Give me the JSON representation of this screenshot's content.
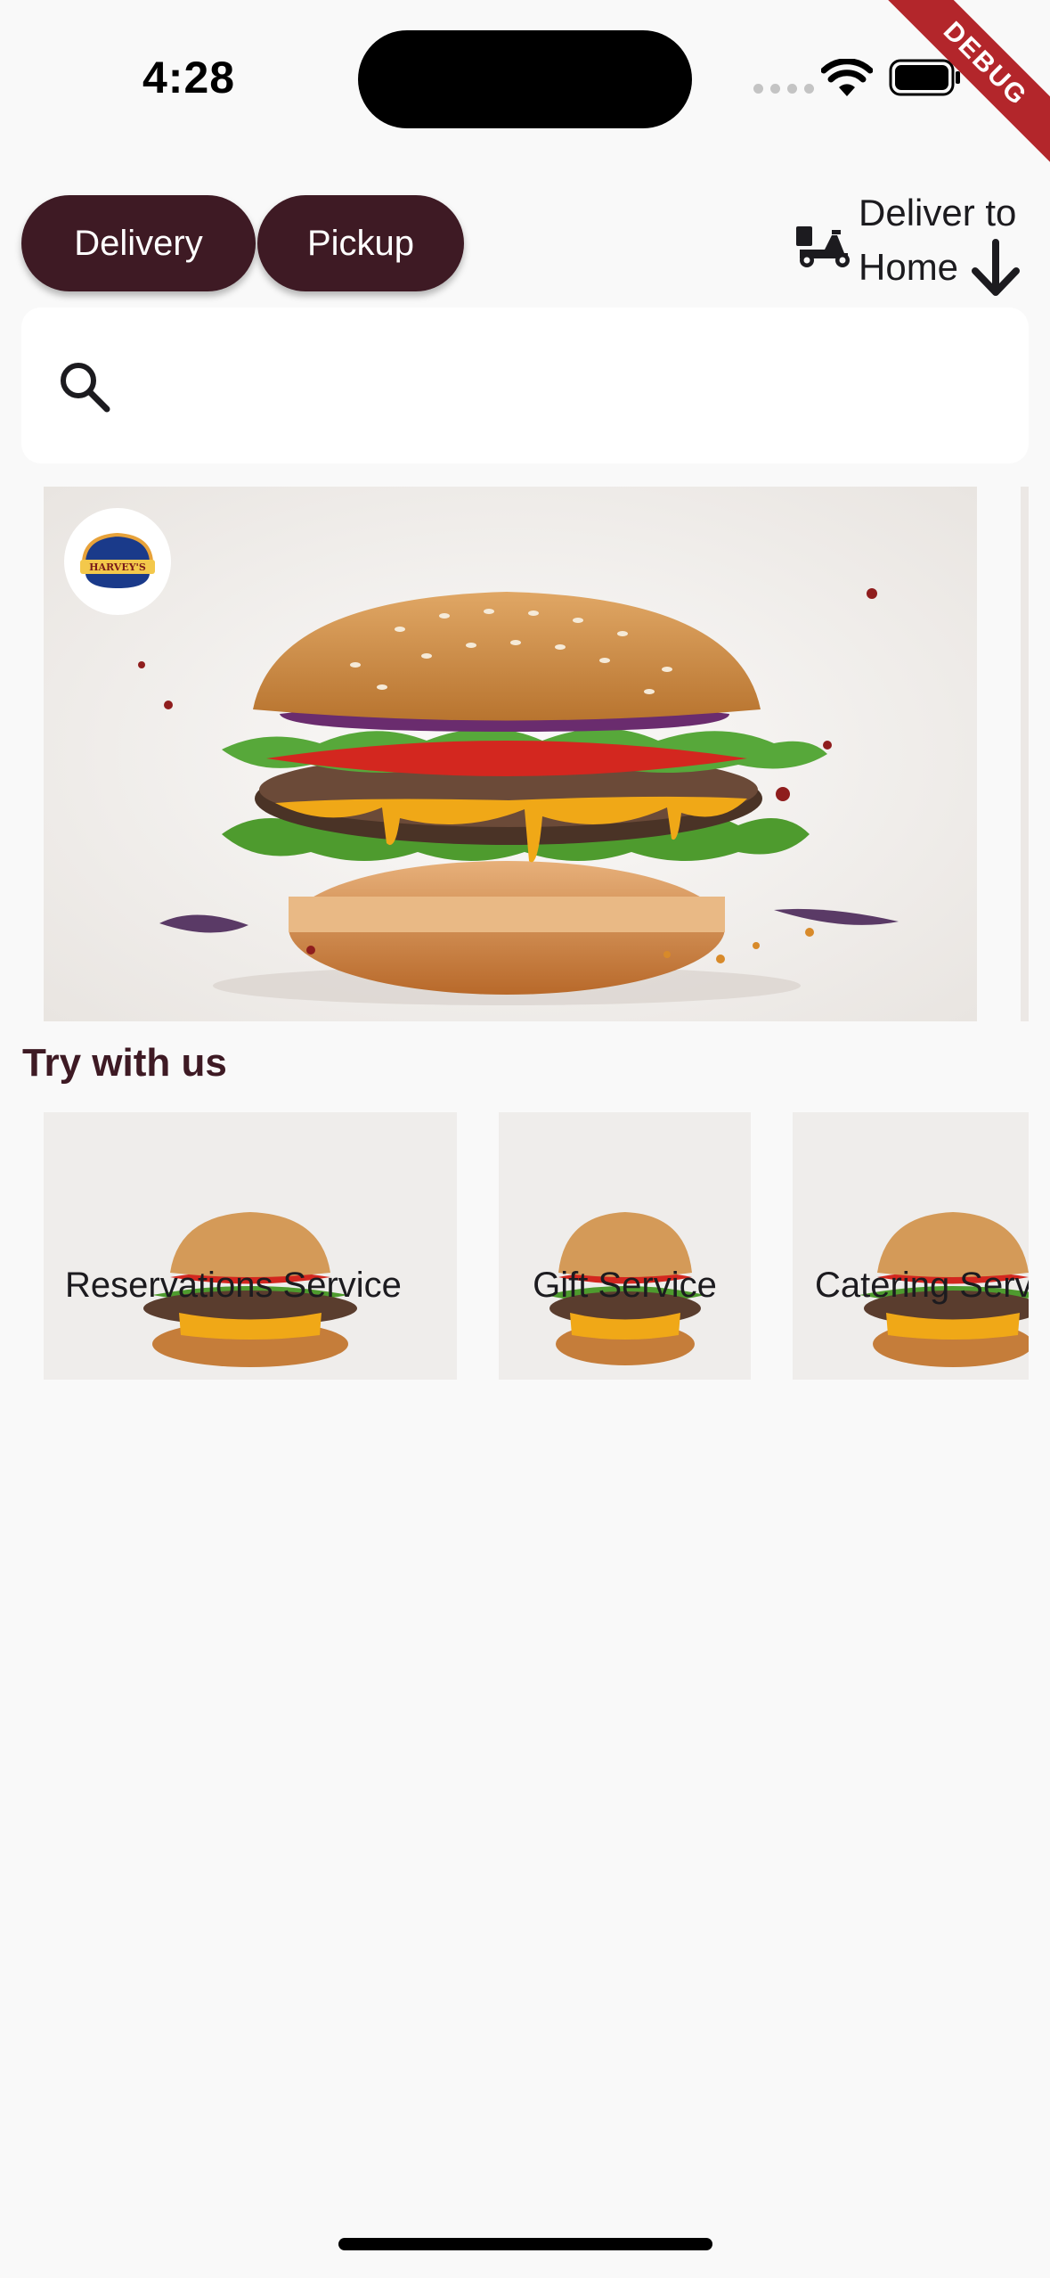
{
  "status_bar": {
    "time": "4:28"
  },
  "debug_banner": "DEBUG",
  "order_mode": {
    "delivery_label": "Delivery",
    "pickup_label": "Pickup"
  },
  "deliver_to": {
    "line1": "Deliver to",
    "line2": "Home"
  },
  "search": {
    "placeholder": ""
  },
  "hero": {
    "logo_text": "HARVEY'S"
  },
  "try_with_us": {
    "title": "Try with us",
    "cards": [
      {
        "label": "Reservations Service"
      },
      {
        "label": "Gift Service"
      },
      {
        "label": "Catering Service"
      }
    ]
  },
  "colors": {
    "primary": "#3e1a24",
    "background": "#f9f9f9",
    "debug": "#b3262b"
  }
}
